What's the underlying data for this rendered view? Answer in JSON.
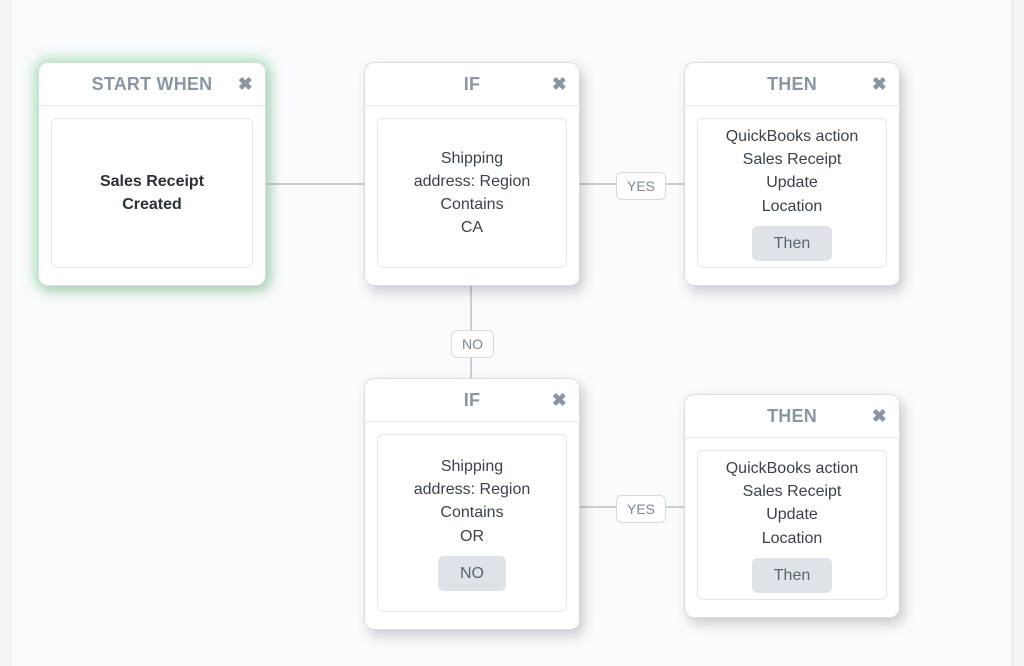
{
  "nodes": {
    "start": {
      "title": "START WHEN",
      "close_glyph": "✖",
      "lines": [
        "Sales Receipt",
        "Created"
      ]
    },
    "if1": {
      "title": "IF",
      "close_glyph": "✖",
      "lines": [
        "Shipping",
        "address: Region",
        "Contains",
        "CA"
      ]
    },
    "then1": {
      "title": "THEN",
      "close_glyph": "✖",
      "lines": [
        "QuickBooks action",
        "Sales Receipt",
        "Update",
        "Location"
      ],
      "pill": "Then"
    },
    "if2": {
      "title": "IF",
      "close_glyph": "✖",
      "lines": [
        "Shipping",
        "address: Region",
        "Contains",
        "OR"
      ],
      "pill": "NO"
    },
    "then2": {
      "title": "THEN",
      "close_glyph": "✖",
      "lines": [
        "QuickBooks action",
        "Sales Receipt",
        "Update",
        "Location"
      ],
      "pill": "Then"
    }
  },
  "edges": {
    "yes1": "YES",
    "no1": "NO",
    "yes2": "YES"
  }
}
